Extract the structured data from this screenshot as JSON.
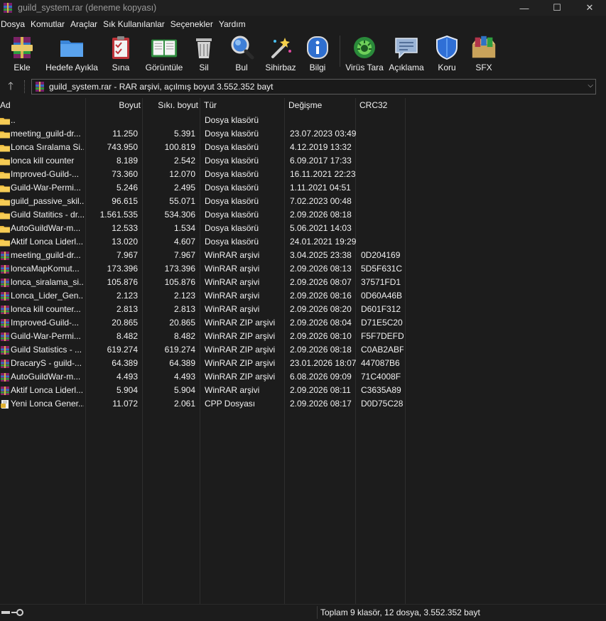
{
  "window": {
    "title": "guild_system.rar (deneme kopyası)",
    "controls": [
      "—",
      "☐",
      "✕"
    ]
  },
  "menu": [
    "Dosya",
    "Komutlar",
    "Araçlar",
    "Sık Kullanılanlar",
    "Seçenekler",
    "Yardım"
  ],
  "toolbar": [
    {
      "label": "Ekle",
      "icon": "add-archive-icon"
    },
    {
      "label": "Hedefe Ayıkla",
      "icon": "extract-to-folder-icon"
    },
    {
      "label": "Sına",
      "icon": "test-clipboard-icon"
    },
    {
      "label": "Görüntüle",
      "icon": "view-book-icon"
    },
    {
      "label": "Sil",
      "icon": "trash-icon"
    },
    {
      "label": "Bul",
      "icon": "find-magnifier-icon"
    },
    {
      "label": "Sihirbaz",
      "icon": "wizard-wand-icon"
    },
    {
      "label": "Bilgi",
      "icon": "info-icon"
    },
    {
      "label": "Virüs Tara",
      "icon": "virus-scan-icon"
    },
    {
      "label": "Açıklama",
      "icon": "comment-icon"
    },
    {
      "label": "Koru",
      "icon": "shield-icon"
    },
    {
      "label": "SFX",
      "icon": "sfx-box-icon"
    }
  ],
  "address": {
    "text": "guild_system.rar - RAR arşivi, açılmış boyut 3.552.352 bayt"
  },
  "columns": {
    "name": "Ad",
    "size": "Boyut",
    "packed": "Sıkı. boyut",
    "type": "Tür",
    "modified": "Değişme",
    "crc": "CRC32"
  },
  "files": [
    {
      "name": "..",
      "size": "",
      "packed": "",
      "type": "Dosya klasörü",
      "modified": "",
      "crc": "",
      "kind": "folder"
    },
    {
      "name": "meeting_guild-dr...",
      "size": "11.250",
      "packed": "5.391",
      "type": "Dosya klasörü",
      "modified": "23.07.2023 03:49",
      "crc": "",
      "kind": "folder"
    },
    {
      "name": "Lonca Sıralama Si...",
      "size": "743.950",
      "packed": "100.819",
      "type": "Dosya klasörü",
      "modified": "4.12.2019 13:32",
      "crc": "",
      "kind": "folder"
    },
    {
      "name": "lonca kill counter",
      "size": "8.189",
      "packed": "2.542",
      "type": "Dosya klasörü",
      "modified": "6.09.2017 17:33",
      "crc": "",
      "kind": "folder"
    },
    {
      "name": "Improved-Guild-...",
      "size": "73.360",
      "packed": "12.070",
      "type": "Dosya klasörü",
      "modified": "16.11.2021 22:23",
      "crc": "",
      "kind": "folder"
    },
    {
      "name": "Guild-War-Permi...",
      "size": "5.246",
      "packed": "2.495",
      "type": "Dosya klasörü",
      "modified": "1.11.2021 04:51",
      "crc": "",
      "kind": "folder"
    },
    {
      "name": "guild_passive_skil...",
      "size": "96.615",
      "packed": "55.071",
      "type": "Dosya klasörü",
      "modified": "7.02.2023 00:48",
      "crc": "",
      "kind": "folder"
    },
    {
      "name": "Guild Statitics - dr...",
      "size": "1.561.535",
      "packed": "534.306",
      "type": "Dosya klasörü",
      "modified": "2.09.2026 08:18",
      "crc": "",
      "kind": "folder"
    },
    {
      "name": "AutoGuildWar-m...",
      "size": "12.533",
      "packed": "1.534",
      "type": "Dosya klasörü",
      "modified": "5.06.2021 14:03",
      "crc": "",
      "kind": "folder"
    },
    {
      "name": "Aktif Lonca Liderl...",
      "size": "13.020",
      "packed": "4.607",
      "type": "Dosya klasörü",
      "modified": "24.01.2021 19:29",
      "crc": "",
      "kind": "folder"
    },
    {
      "name": "meeting_guild-dr...",
      "size": "7.967",
      "packed": "7.967",
      "type": "WinRAR arşivi",
      "modified": "3.04.2025 23:38",
      "crc": "0D204169",
      "kind": "archive"
    },
    {
      "name": "loncaMapKomut...",
      "size": "173.396",
      "packed": "173.396",
      "type": "WinRAR arşivi",
      "modified": "2.09.2026 08:13",
      "crc": "5D5F631C",
      "kind": "archive"
    },
    {
      "name": "lonca_siralama_si...",
      "size": "105.876",
      "packed": "105.876",
      "type": "WinRAR arşivi",
      "modified": "2.09.2026 08:07",
      "crc": "37571FD1",
      "kind": "archive"
    },
    {
      "name": "Lonca_Lider_Gen...",
      "size": "2.123",
      "packed": "2.123",
      "type": "WinRAR arşivi",
      "modified": "2.09.2026 08:16",
      "crc": "0D60A46B",
      "kind": "archive"
    },
    {
      "name": "lonca kill counter...",
      "size": "2.813",
      "packed": "2.813",
      "type": "WinRAR arşivi",
      "modified": "2.09.2026 08:20",
      "crc": "D601F312",
      "kind": "archive"
    },
    {
      "name": "Improved-Guild-...",
      "size": "20.865",
      "packed": "20.865",
      "type": "WinRAR ZIP arşivi",
      "modified": "2.09.2026 08:04",
      "crc": "D71E5C20",
      "kind": "archive"
    },
    {
      "name": "Guild-War-Permi...",
      "size": "8.482",
      "packed": "8.482",
      "type": "WinRAR ZIP arşivi",
      "modified": "2.09.2026 08:10",
      "crc": "F5F7DEFD",
      "kind": "archive"
    },
    {
      "name": "Guild Statistics - ...",
      "size": "619.274",
      "packed": "619.274",
      "type": "WinRAR ZIP arşivi",
      "modified": "2.09.2026 08:18",
      "crc": "C0AB2ABF",
      "kind": "archive"
    },
    {
      "name": "DracaryS - guild-...",
      "size": "64.389",
      "packed": "64.389",
      "type": "WinRAR ZIP arşivi",
      "modified": "23.01.2026 18:07",
      "crc": "447087B6",
      "kind": "archive"
    },
    {
      "name": "AutoGuildWar-m...",
      "size": "4.493",
      "packed": "4.493",
      "type": "WinRAR ZIP arşivi",
      "modified": "6.08.2026 09:09",
      "crc": "71C4008F",
      "kind": "archive"
    },
    {
      "name": "Aktif Lonca Liderl...",
      "size": "5.904",
      "packed": "5.904",
      "type": "WinRAR arşivi",
      "modified": "2.09.2026 08:11",
      "crc": "C3635A89",
      "kind": "archive"
    },
    {
      "name": "Yeni Lonca Gener...",
      "size": "11.072",
      "packed": "2.061",
      "type": "CPP Dosyası",
      "modified": "2.09.2026 08:17",
      "crc": "D0D75C28",
      "kind": "cpp"
    }
  ],
  "status": {
    "text": "Toplam 9 klasör, 12 dosya, 3.552.352 bayt"
  },
  "colors": {
    "background": "#1c1c1c",
    "text": "#f0f0f0",
    "folder": "#f4c542",
    "archive": "#b02a3a"
  }
}
